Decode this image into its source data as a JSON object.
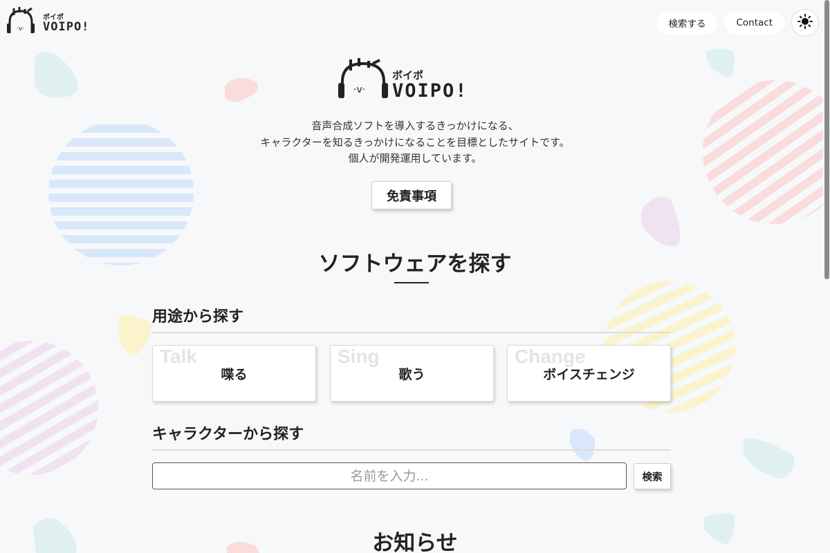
{
  "header": {
    "logo_text": "VOIPO!",
    "logo_kana": "ボイポ",
    "nav": [
      {
        "label": "検索する"
      },
      {
        "label": "Contact"
      }
    ],
    "theme_icon": "sun-icon"
  },
  "hero": {
    "logo_text": "VOIPO!",
    "logo_kana": "ボイポ",
    "intro_lines": [
      "音声合成ソフトを導入するきっかけになる、",
      "キャラクターを知るきっかけになることを目標としたサイトです。",
      "個人が開発運用しています。"
    ],
    "disclaimer_label": "免責事項"
  },
  "software": {
    "title": "ソフトウェアを探す",
    "by_use": {
      "heading": "用途から探す",
      "categories": [
        {
          "en": "Talk",
          "label": "喋る"
        },
        {
          "en": "Sing",
          "label": "歌う"
        },
        {
          "en": "Change",
          "label": "ボイスチェンジ"
        }
      ]
    },
    "by_character": {
      "heading": "キャラクターから探す",
      "placeholder": "名前を入力...",
      "search_label": "検索"
    }
  },
  "news": {
    "title": "お知らせ"
  },
  "colors": {
    "background": "#f6f8fa",
    "text": "#222222",
    "deco_blue": "#d9e7fb",
    "deco_pink": "#fadcdc",
    "deco_yellow": "#fbf3cc",
    "deco_purple": "#f0e0f0",
    "deco_teal": "#dff0ef"
  }
}
